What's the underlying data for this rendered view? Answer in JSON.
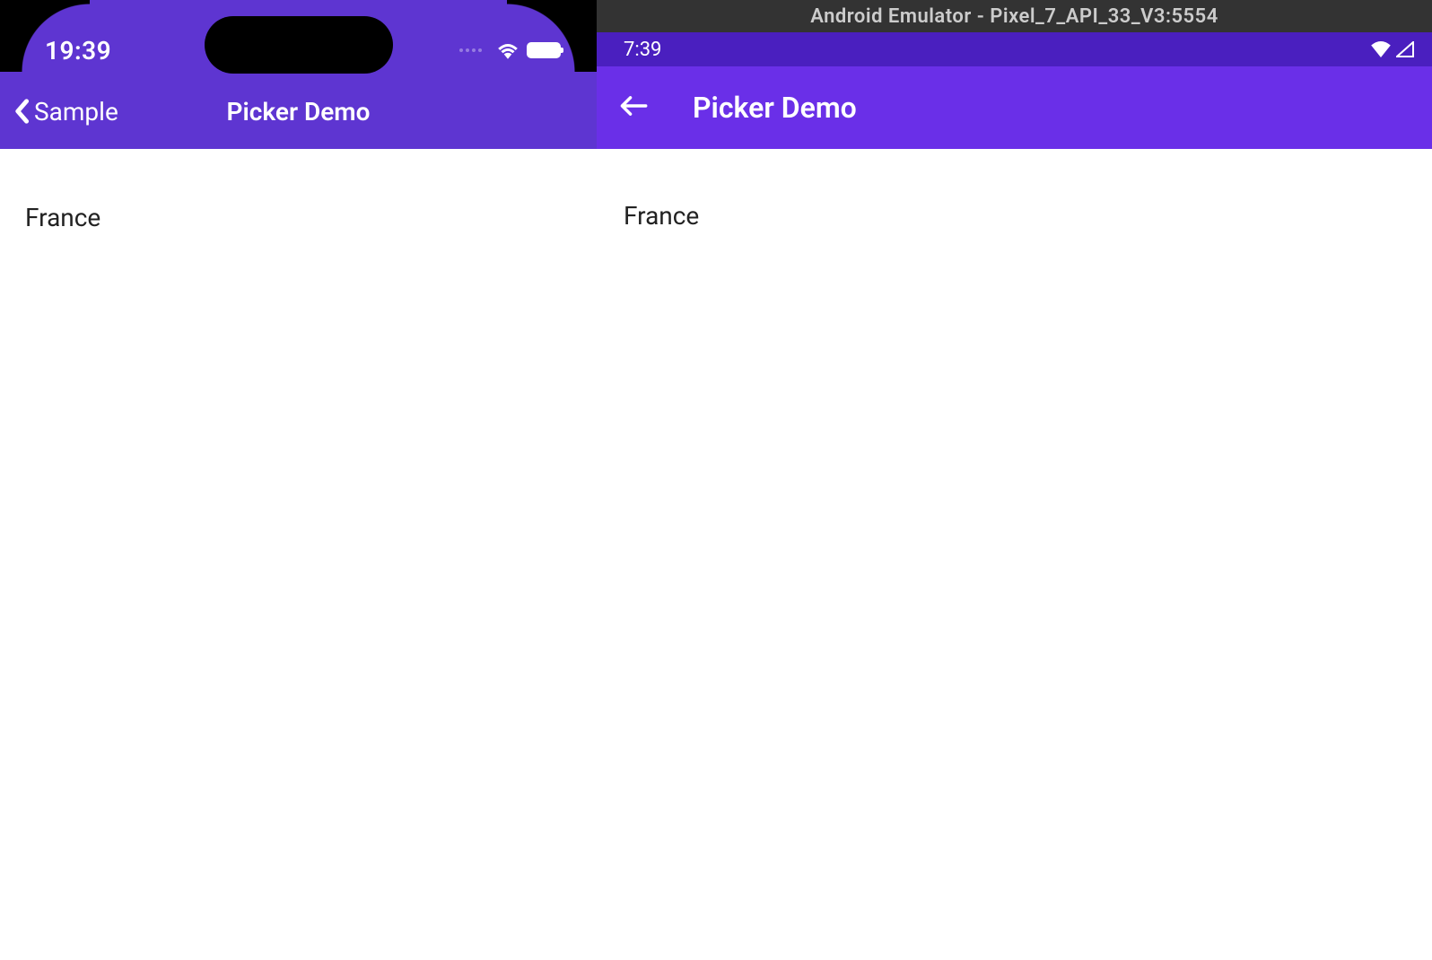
{
  "ios": {
    "statusbar": {
      "time": "19:39"
    },
    "navbar": {
      "back_label": "Sample",
      "title": "Picker Demo"
    },
    "content": {
      "picker_value": "France"
    }
  },
  "android": {
    "emulator_bar": "Android Emulator - Pixel_7_API_33_V3:5554",
    "statusbar": {
      "time": "7:39"
    },
    "navbar": {
      "title": "Picker Demo"
    },
    "content": {
      "picker_value": "France"
    }
  }
}
